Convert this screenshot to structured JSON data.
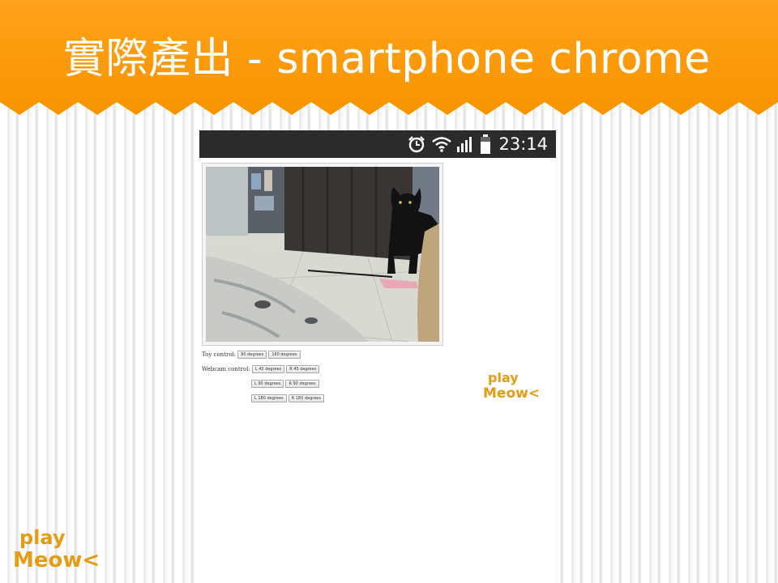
{
  "slide": {
    "title": "實際產出 - smartphone chrome"
  },
  "statusbar": {
    "icons": [
      "alarm-icon",
      "wifi-icon",
      "signal-icon",
      "battery-icon"
    ],
    "time": "23:14"
  },
  "page": {
    "toy_label": "Toy control:",
    "toy_buttons": [
      "90 degrees",
      "180 degrees"
    ],
    "webcam_label": "Webcam control:",
    "webcam_rows": [
      [
        "L 45 degrees",
        "R 45 degrees"
      ],
      [
        "L 90 degrees",
        "R 90 degrees"
      ],
      [
        "L 180 degrees",
        "R 180 degrees"
      ]
    ]
  },
  "logo": {
    "line1": "play",
    "line2": "Meow<"
  },
  "colors": {
    "header_orange": "#f79400",
    "logo_orange": "#e59b12",
    "statusbar": "#2b2b2b"
  }
}
